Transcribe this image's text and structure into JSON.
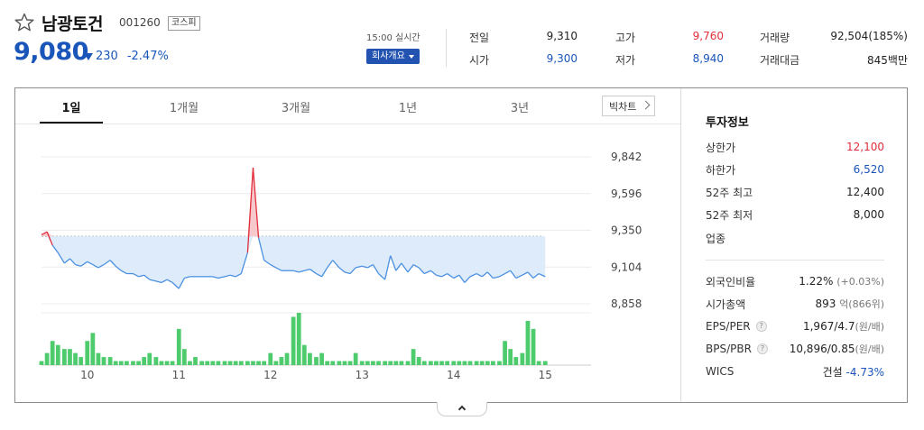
{
  "stock": {
    "name": "남광토건",
    "code": "001260",
    "market": "코스피",
    "price": "9,080",
    "change": "230",
    "change_rate": "-2.47%"
  },
  "meta": {
    "realtime": "15:00 실시간",
    "company_button": "회사개요"
  },
  "quotes": {
    "prev_label": "전일",
    "prev_value": "9,310",
    "high_label": "고가",
    "high_value": "9,760",
    "volume_label": "거래량",
    "volume_value": "92,504(185%)",
    "open_label": "시가",
    "open_value": "9,300",
    "low_label": "저가",
    "low_value": "8,940",
    "amount_label": "거래대금",
    "amount_value": "845백만"
  },
  "tabs": [
    "1일",
    "1개월",
    "3개월",
    "1년",
    "3년"
  ],
  "chart_button": "빅차트",
  "colors": {
    "down": "#1a55b9",
    "up": "#e22e3a",
    "line": "#4a90e2",
    "fill": "#ddebfb",
    "volume": "#4ecb6d"
  },
  "investment": {
    "title": "투자정보",
    "upper_limit_label": "상한가",
    "upper_limit": "12,100",
    "lower_limit_label": "하한가",
    "lower_limit": "6,520",
    "week52_high_label": "52주 최고",
    "week52_high": "12,400",
    "week52_low_label": "52주 최저",
    "week52_low": "8,000",
    "sector_label": "업종",
    "foreign_label": "외국인비율",
    "foreign_value": "1.22%",
    "foreign_change": "(+0.03%)",
    "mcap_label": "시가총액",
    "mcap_value": "893",
    "mcap_unit": "억(866위)",
    "eps_label": "EPS/PER",
    "eps_value": "1,967/4.7",
    "eps_unit": "(원/배)",
    "bps_label": "BPS/PBR",
    "bps_value": "10,896/0.85",
    "bps_unit": "(원/배)",
    "wics_label": "WICS",
    "wics_value": "건설",
    "wics_change": "-4.73%",
    "help_glyph": "?"
  },
  "chart_data": {
    "type": "line",
    "title": "",
    "prev_close": 9310,
    "ylim": [
      8858,
      9842
    ],
    "y_ticks": [
      "9,842",
      "9,596",
      "9,350",
      "9,104",
      "8,858"
    ],
    "y_tick_values": [
      9842,
      9596,
      9350,
      9104,
      8858
    ],
    "x_ticks": [
      "10",
      "11",
      "12",
      "13",
      "14",
      "15"
    ],
    "x_tick_positions": [
      9.5,
      10.5,
      11.5,
      12.5,
      13.5,
      14.5
    ],
    "xlim": [
      9.0,
      15.0
    ],
    "x": [
      9.0,
      9.06,
      9.12,
      9.18,
      9.25,
      9.31,
      9.37,
      9.43,
      9.5,
      9.56,
      9.62,
      9.68,
      9.75,
      9.81,
      9.87,
      9.93,
      10.0,
      10.06,
      10.12,
      10.18,
      10.25,
      10.31,
      10.37,
      10.43,
      10.5,
      10.56,
      10.62,
      10.68,
      10.75,
      10.81,
      10.87,
      10.93,
      11.0,
      11.06,
      11.12,
      11.18,
      11.25,
      11.31,
      11.37,
      11.43,
      11.5,
      11.56,
      11.62,
      11.68,
      11.75,
      11.81,
      11.87,
      11.93,
      12.0,
      12.06,
      12.12,
      12.18,
      12.25,
      12.31,
      12.37,
      12.43,
      12.5,
      12.56,
      12.62,
      12.68,
      12.75,
      12.81,
      12.87,
      12.93,
      13.0,
      13.06,
      13.12,
      13.18,
      13.25,
      13.31,
      13.37,
      13.43,
      13.5,
      13.56,
      13.62,
      13.68,
      13.75,
      13.81,
      13.87,
      13.93,
      14.0,
      14.06,
      14.12,
      14.18,
      14.25,
      14.31,
      14.37,
      14.43,
      14.5
    ],
    "y": [
      9320,
      9340,
      9250,
      9200,
      9130,
      9160,
      9120,
      9110,
      9140,
      9120,
      9100,
      9120,
      9150,
      9110,
      9080,
      9060,
      9060,
      9040,
      9050,
      9020,
      9010,
      9000,
      9020,
      9000,
      8960,
      9030,
      9040,
      9040,
      9040,
      9040,
      9040,
      9030,
      9040,
      9050,
      9040,
      9060,
      9200,
      9770,
      9300,
      9150,
      9120,
      9100,
      9080,
      9080,
      9080,
      9070,
      9080,
      9090,
      9060,
      9040,
      9100,
      9150,
      9100,
      9070,
      9060,
      9100,
      9110,
      9100,
      9120,
      9060,
      9020,
      9180,
      9080,
      9130,
      9070,
      9120,
      9100,
      9060,
      9080,
      9050,
      9040,
      9060,
      9030,
      9050,
      9000,
      9040,
      9060,
      9040,
      9070,
      9030,
      9040,
      9060,
      9080,
      9030,
      9050,
      9070,
      9030,
      9060,
      9040
    ],
    "volume": [
      1,
      3,
      6,
      5,
      4,
      4,
      3,
      2,
      6,
      8,
      3,
      2,
      2,
      1,
      1,
      1,
      1,
      1,
      2,
      3,
      2,
      1,
      1,
      1,
      9,
      4,
      1,
      2,
      1,
      1,
      1,
      1,
      1,
      1,
      1,
      1,
      1,
      1,
      1,
      1,
      3,
      1,
      2,
      3,
      12,
      13,
      5,
      3,
      2,
      3,
      1,
      1,
      1,
      1,
      1,
      3,
      1,
      1,
      1,
      1,
      1,
      1,
      1,
      1,
      1,
      4,
      2,
      1,
      1,
      1,
      1,
      1,
      1,
      1,
      1,
      1,
      1,
      1,
      1,
      1,
      1,
      6,
      4,
      2,
      3,
      11,
      9,
      1,
      1
    ]
  }
}
